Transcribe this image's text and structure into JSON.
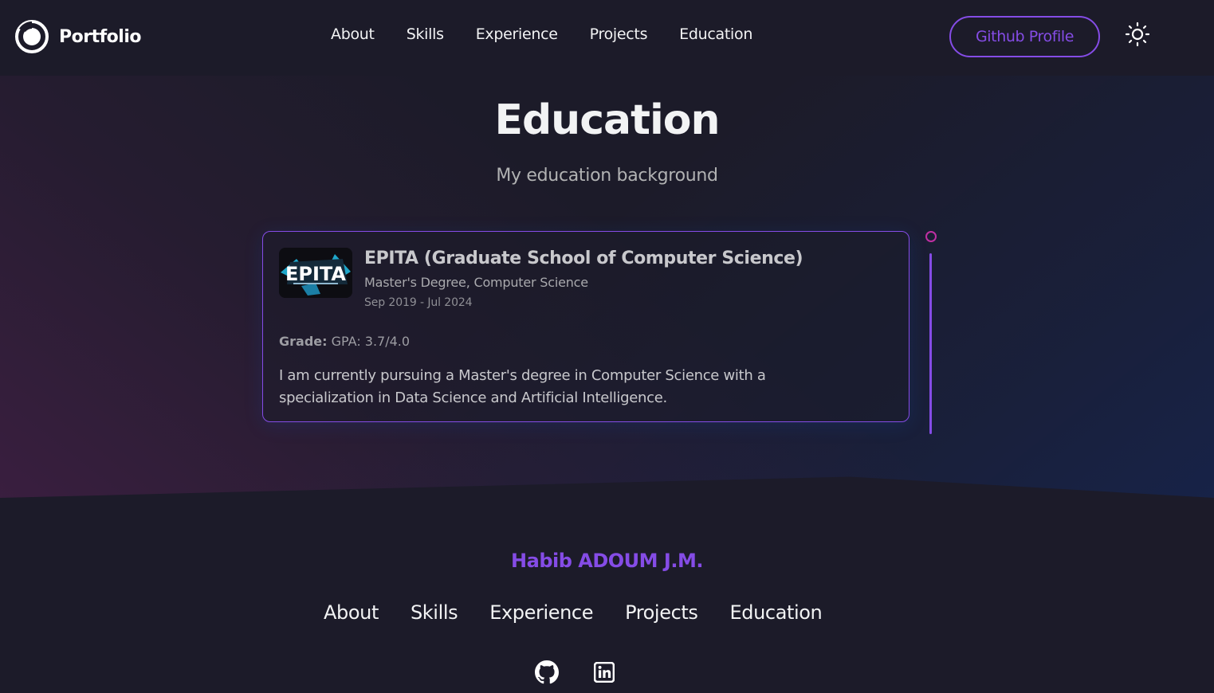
{
  "navbar": {
    "brand": "Portfolio",
    "links": [
      "About",
      "Skills",
      "Experience",
      "Projects",
      "Education"
    ],
    "github_button": "Github Profile",
    "theme_icon": "sun-icon"
  },
  "section": {
    "title": "Education",
    "description": "My education background"
  },
  "education": [
    {
      "logo_text": "EPITA",
      "school": "EPITA (Graduate School of Computer Science)",
      "degree": "Master's Degree, Computer Science",
      "date": "Sep 2019 - Jul 2024",
      "grade_label": "Grade:",
      "grade_value": "GPA: 3.7/4.0",
      "description": "I am currently pursuing a Master's degree in Computer Science with a specialization in Data Science and Artificial Intelligence."
    }
  ],
  "footer": {
    "name": "Habib ADOUM J.M.",
    "links": [
      "About",
      "Skills",
      "Experience",
      "Projects",
      "Education"
    ],
    "social_icons": [
      "github-icon",
      "linkedin-icon"
    ]
  },
  "colors": {
    "background": "#1c1b29",
    "primary": "#854ce6",
    "accent": "#bf2fa3",
    "text_primary": "#f2f3f4",
    "text_secondary": "#b1b2b3"
  }
}
